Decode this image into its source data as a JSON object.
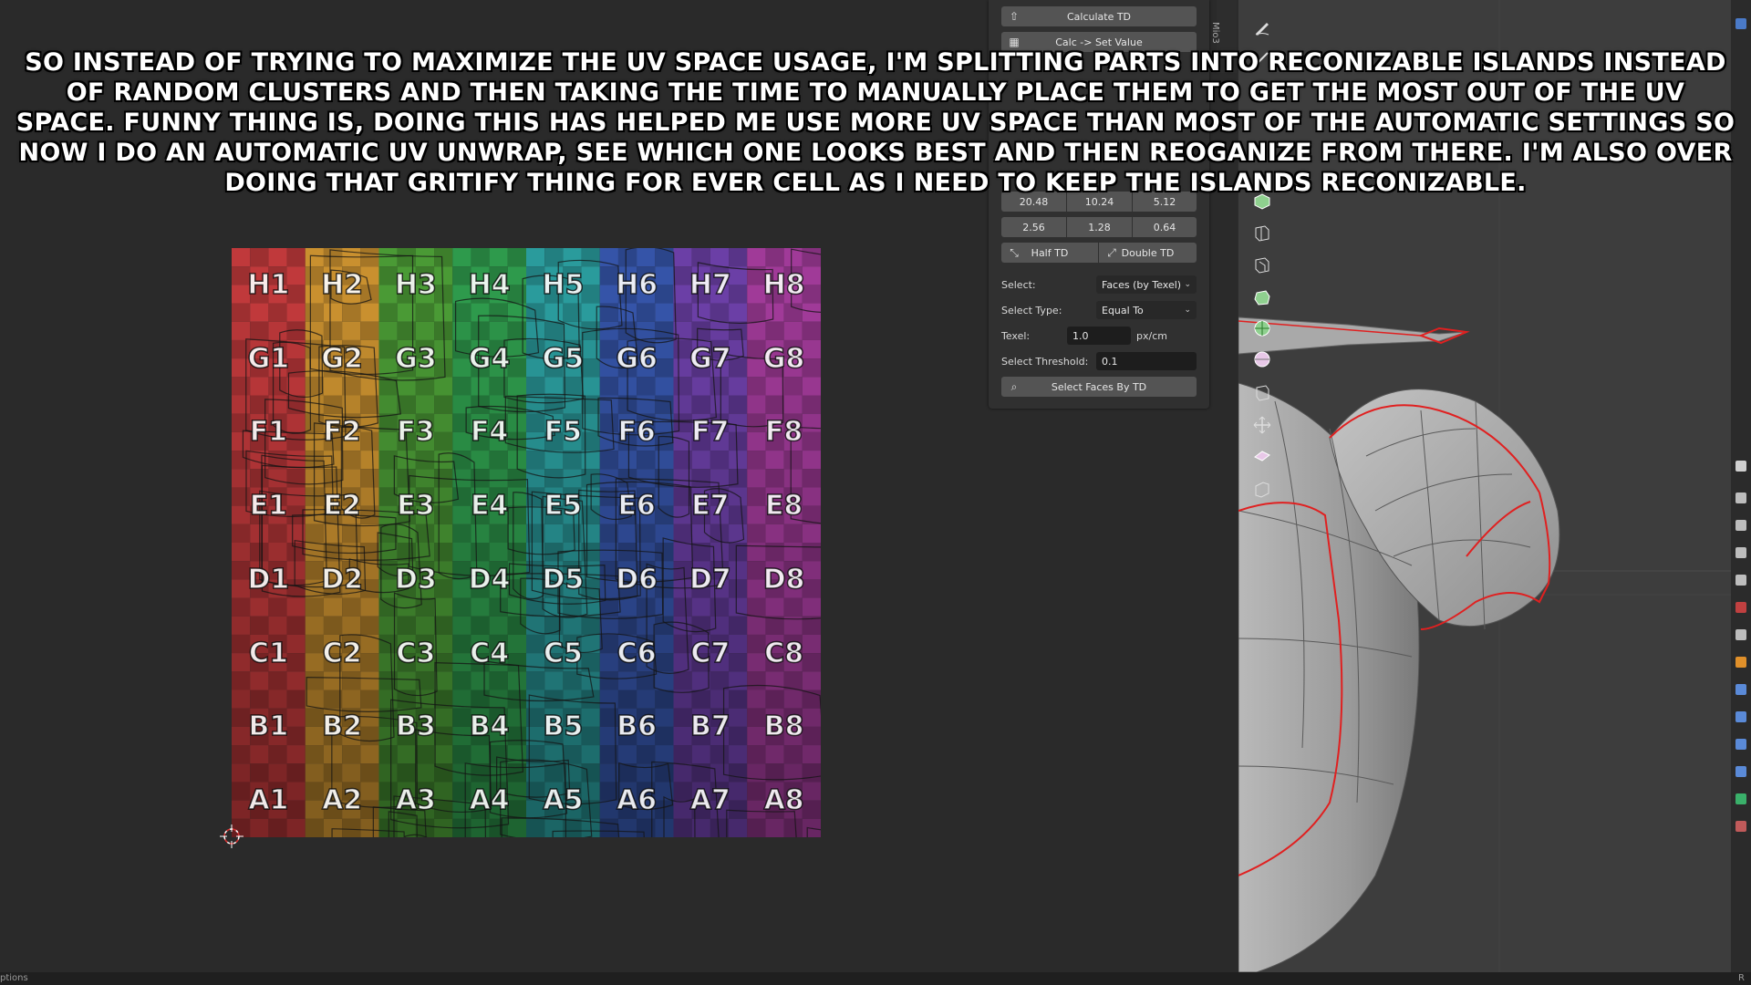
{
  "caption": "So instead of trying to maximize the UV space usage, I'm splitting parts into reconizable islands instead of random clusters and then taking the time to manually place them to get the most out of the UV space. Funny thing is, doing this has helped me use more UV space than most of the automatic settings so now I do an automatic UV unwrap, see which one looks best and then reoganize from there. I'm also over doing that gritify thing for ever cell as I need to keep the islands reconizable.",
  "uv_grid": {
    "rows": [
      "H",
      "G",
      "F",
      "E",
      "D",
      "C",
      "B",
      "A"
    ],
    "columns": [
      "1",
      "2",
      "3",
      "4",
      "5",
      "6",
      "7",
      "8"
    ],
    "column_colors": [
      "#c0393b",
      "#c9902f",
      "#4a9a35",
      "#2e9a4c",
      "#2a9b9c",
      "#3554a8",
      "#6b3fa6",
      "#a03a98"
    ],
    "labels": [
      [
        "H1",
        "H2",
        "H3",
        "H4",
        "H5",
        "H6",
        "H7",
        "H8"
      ],
      [
        "G1",
        "G2",
        "G3",
        "G4",
        "G5",
        "G6",
        "G7",
        "G8"
      ],
      [
        "F1",
        "F2",
        "F3",
        "F4",
        "F5",
        "F6",
        "F7",
        "F8"
      ],
      [
        "E1",
        "E2",
        "E3",
        "E4",
        "E5",
        "E6",
        "E7",
        "E8"
      ],
      [
        "D1",
        "D2",
        "D3",
        "D4",
        "D5",
        "D6",
        "D7",
        "D8"
      ],
      [
        "C1",
        "C2",
        "C3",
        "C4",
        "C5",
        "C6",
        "C7",
        "C8"
      ],
      [
        "B1",
        "B2",
        "B3",
        "B4",
        "B5",
        "B6",
        "B7",
        "B8"
      ],
      [
        "A1",
        "A2",
        "A3",
        "A4",
        "A5",
        "A6",
        "A7",
        "A8"
      ]
    ]
  },
  "panel": {
    "calculate_td": "Calculate TD",
    "calc_set_value": "Calc -> Set Value",
    "row1": [
      "20.48",
      "10.24",
      "5.12"
    ],
    "row2": [
      "2.56",
      "1.28",
      "0.64"
    ],
    "half_td": "Half TD",
    "double_td": "Double TD",
    "select_label": "Select:",
    "select_value": "Faces (by Texel)",
    "select_type_label": "Select Type:",
    "select_type_value": "Equal To",
    "texel_label": "Texel:",
    "texel_value": "1.0",
    "texel_unit": "px/cm",
    "threshold_label": "Select Threshold:",
    "threshold_value": "0.1",
    "select_faces_btn": "Select Faces By TD",
    "vertical_tab": "Mio3"
  },
  "toolbar_icons": [
    "annotate-icon",
    "measure-icon",
    "add-cube-icon",
    "extrude-icon",
    "inset-icon",
    "bevel-icon",
    "loop-cut-icon",
    "knife-icon",
    "poly-build-icon",
    "spin-icon",
    "smooth-icon",
    "shrink-icon",
    "shear-icon",
    "rip-icon"
  ],
  "status": {
    "left": "ptions",
    "right": "R"
  },
  "colors": {
    "edge_highlight": "#e02020",
    "panel_bg": "#303030",
    "button_bg": "#545454"
  }
}
